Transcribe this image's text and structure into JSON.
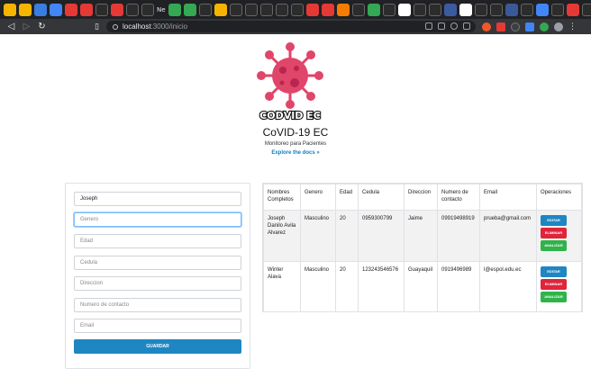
{
  "browser": {
    "tab_labels": [
      "Ne",
      "Ne"
    ],
    "url_host": "localhost",
    "url_path": ":3000/inicio"
  },
  "header": {
    "logo_text": "CODVID EC",
    "title": "CoVID-19 EC",
    "subtitle": "Monitoreo para Pacientes",
    "link": "Explore the docs »"
  },
  "form": {
    "nombre_value": "Joseph",
    "genero_placeholder": "Genero",
    "edad_placeholder": "Edad",
    "cedula_placeholder": "Cedula",
    "direccion_placeholder": "Direccion",
    "numero_placeholder": "Numero de contacto",
    "email_placeholder": "Email",
    "save_label": "GUARDAR"
  },
  "table": {
    "headers": [
      "Nombres Completos",
      "Genero",
      "Edad",
      "Cedula",
      "Direccion",
      "Numero de contacto",
      "Email",
      "Operaciones"
    ],
    "rows": [
      [
        "Joseph Danilo Avila Alvarez",
        "Masculino",
        "20",
        "0959300799",
        "Jaime",
        "09919498919",
        "prueba@gmail.com"
      ],
      [
        "Winter Alava",
        "Masculino",
        "20",
        "123243546576",
        "Guayaquil",
        "0919496989",
        "l@espol.edu.ec"
      ]
    ],
    "op_labels": [
      "EDITAR",
      "ELIMINAR",
      "ANALIZAR"
    ]
  },
  "colors": {
    "primary": "#1e86c2",
    "danger": "#e0243a",
    "success": "#2fb34a",
    "virus": "#e0456a"
  }
}
